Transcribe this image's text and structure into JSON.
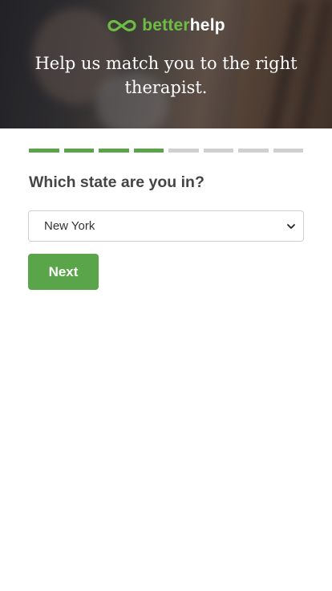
{
  "header": {
    "logo_better": "better",
    "logo_help": "help",
    "title": "Help us match you to the right therapist."
  },
  "progress": {
    "total_steps": 8,
    "completed_steps": 4,
    "done_color": "#5aa44a",
    "todo_color": "#d0d0d0"
  },
  "question": {
    "label": "Which state are you in?",
    "selected_value": "New York"
  },
  "actions": {
    "next_label": "Next"
  },
  "colors": {
    "brand_green": "#5aa44a",
    "text_dark": "#454545"
  },
  "icons": {
    "logo": "betterhelp-logo-icon",
    "dropdown": "chevron-down-icon"
  }
}
